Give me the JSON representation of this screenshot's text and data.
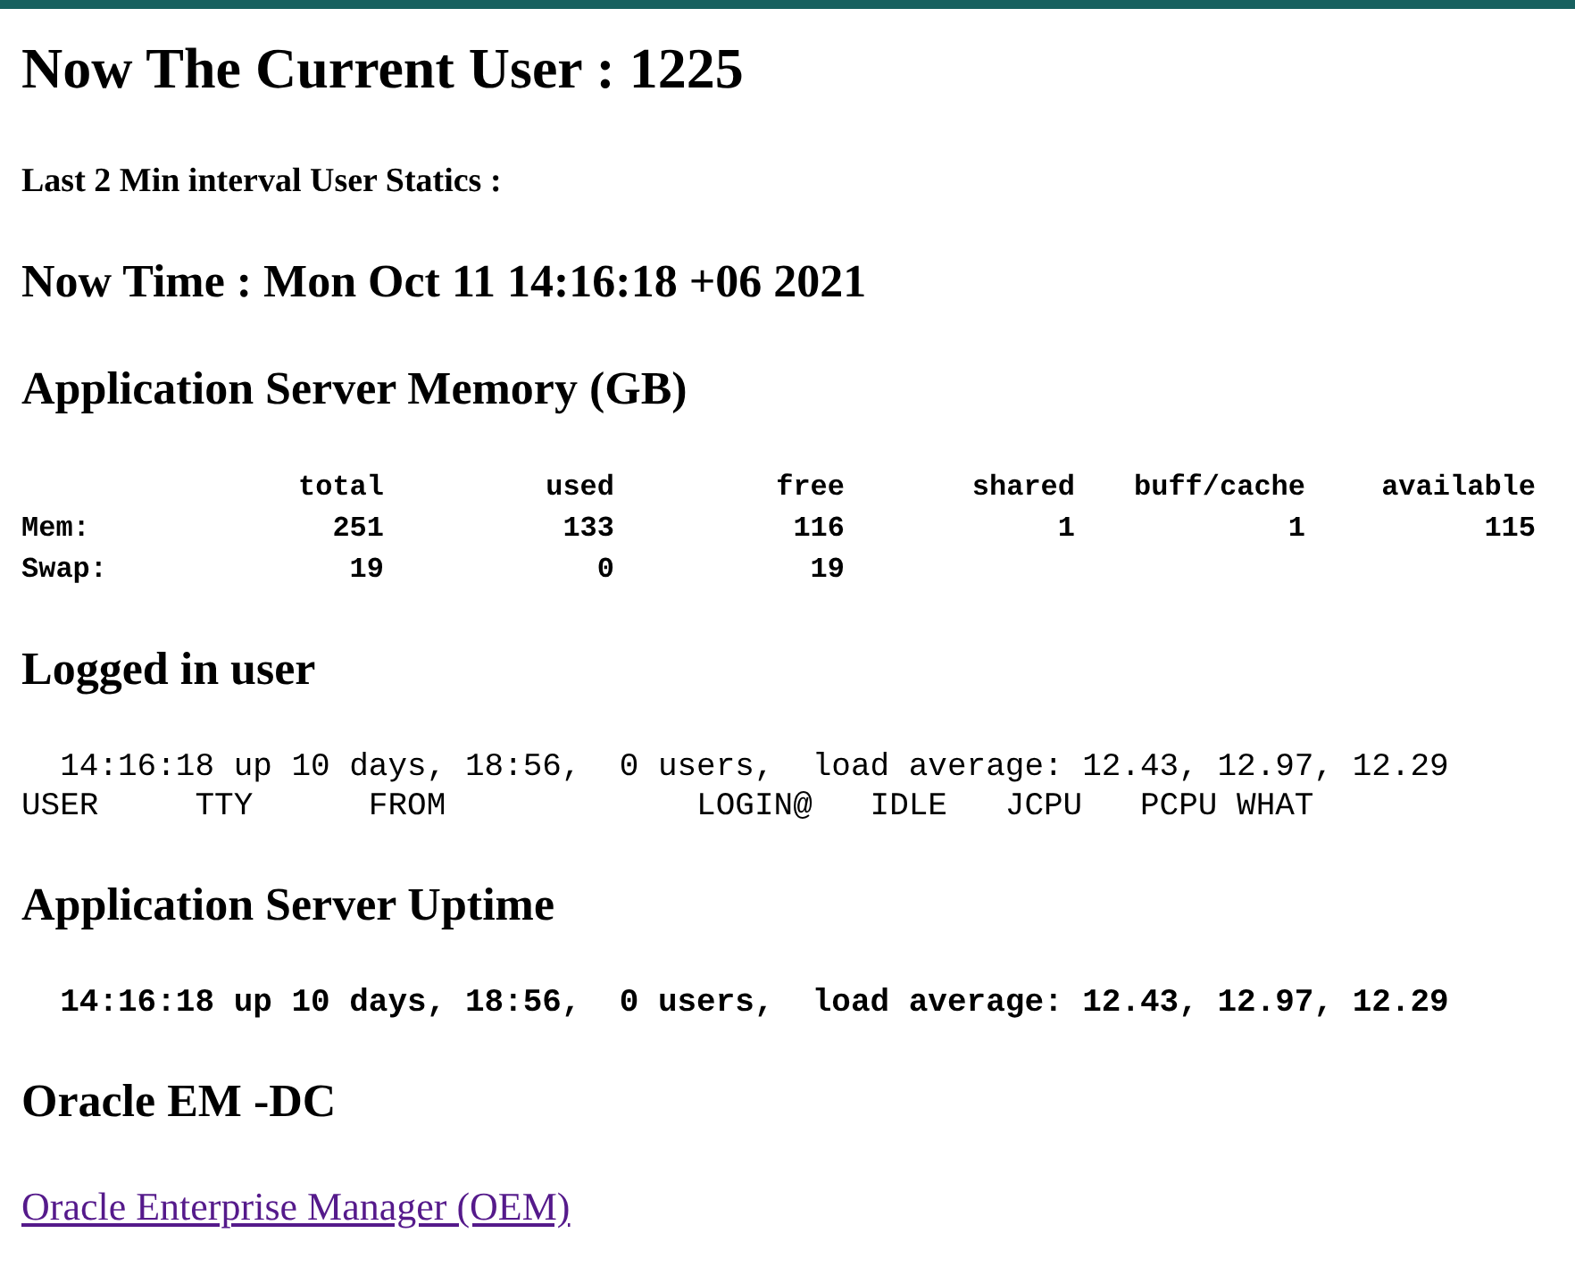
{
  "title": "Now The Current User : 1225",
  "subtitle": "Last 2 Min interval User Statics :",
  "now_time": "Now Time : Mon Oct 11 14:16:18 +06 2021",
  "sections": [
    {
      "kind": "table",
      "heading": "Application Server Memory (GB)",
      "columns": [
        "total",
        "used",
        "free",
        "shared",
        "buff/cache",
        "available"
      ],
      "rows": [
        {
          "label": "Mem:",
          "cells": [
            "251",
            "133",
            "116",
            "1",
            "1",
            "115"
          ]
        },
        {
          "label": "Swap:",
          "cells": [
            "19",
            "0",
            "19"
          ]
        }
      ]
    },
    {
      "kind": "text",
      "heading": "Logged in user",
      "bold": false,
      "lines": [
        "  14:16:18 up 10 days, 18:56,  0 users,  load average: 12.43, 12.97, 12.29",
        "USER     TTY      FROM             LOGIN@   IDLE   JCPU   PCPU WHAT"
      ]
    },
    {
      "kind": "text",
      "heading": "Application Server Uptime",
      "bold": true,
      "lines": [
        "  14:16:18 up 10 days, 18:56,  0 users,  load average: 12.43, 12.97, 12.29"
      ]
    },
    {
      "kind": "link",
      "heading": "Oracle EM -DC",
      "link": "Oracle Enterprise Manager (OEM)"
    }
  ]
}
